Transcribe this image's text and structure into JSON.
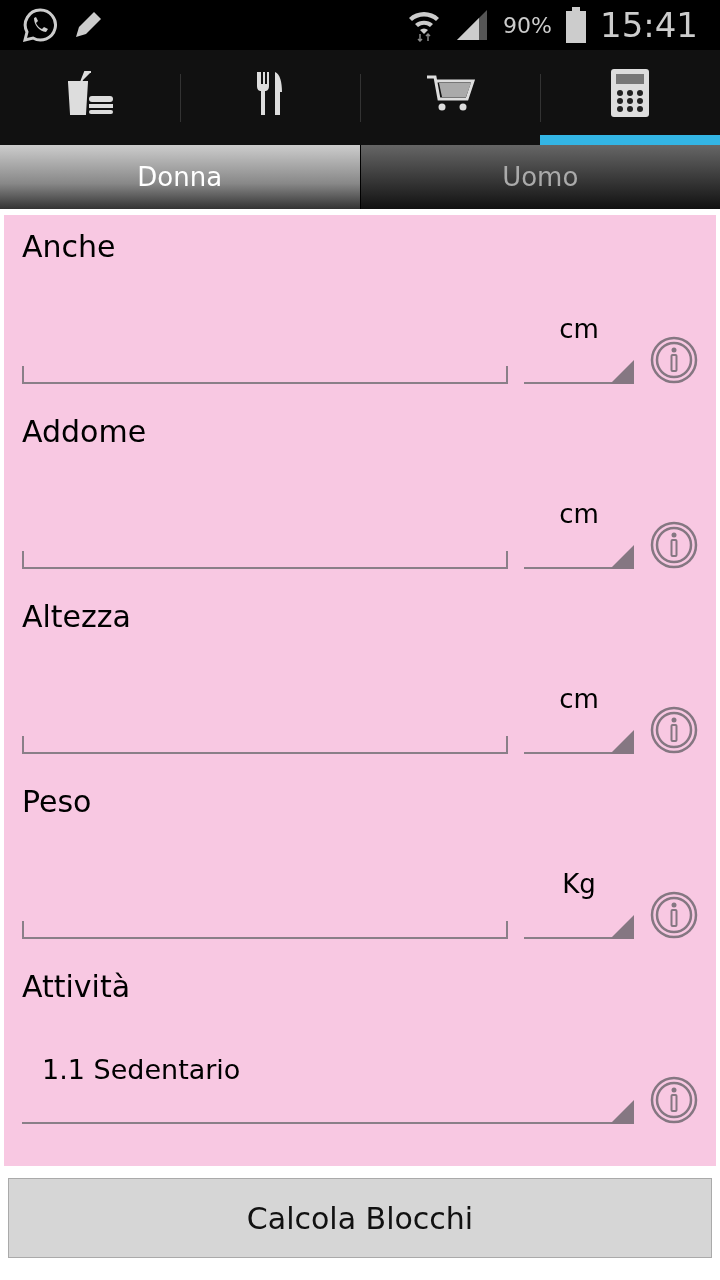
{
  "status_bar": {
    "battery": "90%",
    "time": "15:41"
  },
  "tabs": [
    {
      "selected": false
    },
    {
      "selected": false
    },
    {
      "selected": false
    },
    {
      "selected": true
    }
  ],
  "gender": [
    {
      "label": "Donna",
      "selected": true
    },
    {
      "label": "Uomo",
      "selected": false
    }
  ],
  "fields": [
    {
      "label": "Anche",
      "unit": "cm"
    },
    {
      "label": "Addome",
      "unit": "cm"
    },
    {
      "label": "Altezza",
      "unit": "cm"
    },
    {
      "label": "Peso",
      "unit": "Kg"
    }
  ],
  "activity": {
    "label": "Attività",
    "value": "1.1 Sedentario"
  },
  "button": "Calcola Blocchi"
}
